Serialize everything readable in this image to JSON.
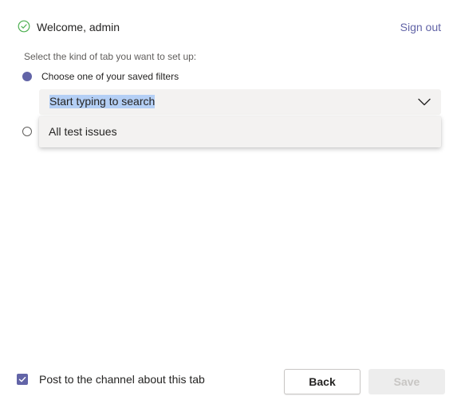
{
  "header": {
    "welcome_text": "Welcome, admin",
    "sign_out_label": "Sign out"
  },
  "setup": {
    "prompt": "Select the kind of tab you want to set up:",
    "options": [
      {
        "label": "Choose one of your saved filters",
        "selected": true
      },
      {
        "label": "",
        "selected": false
      }
    ]
  },
  "filter_dropdown": {
    "value": "Start typing to search",
    "options": [
      "All test issues"
    ]
  },
  "footer": {
    "post_checkbox_label": "Post to the channel about this tab",
    "post_checked": true,
    "back_label": "Back",
    "save_label": "Save"
  },
  "colors": {
    "accent": "#6264a7",
    "success": "#4caf50",
    "dropdown_bg": "#f3f2f1",
    "disabled_text": "#c8c6c4"
  },
  "icons": {
    "welcome": "check-circle-icon",
    "dropdown": "chevron-down-icon",
    "checkbox": "checkmark-icon"
  }
}
